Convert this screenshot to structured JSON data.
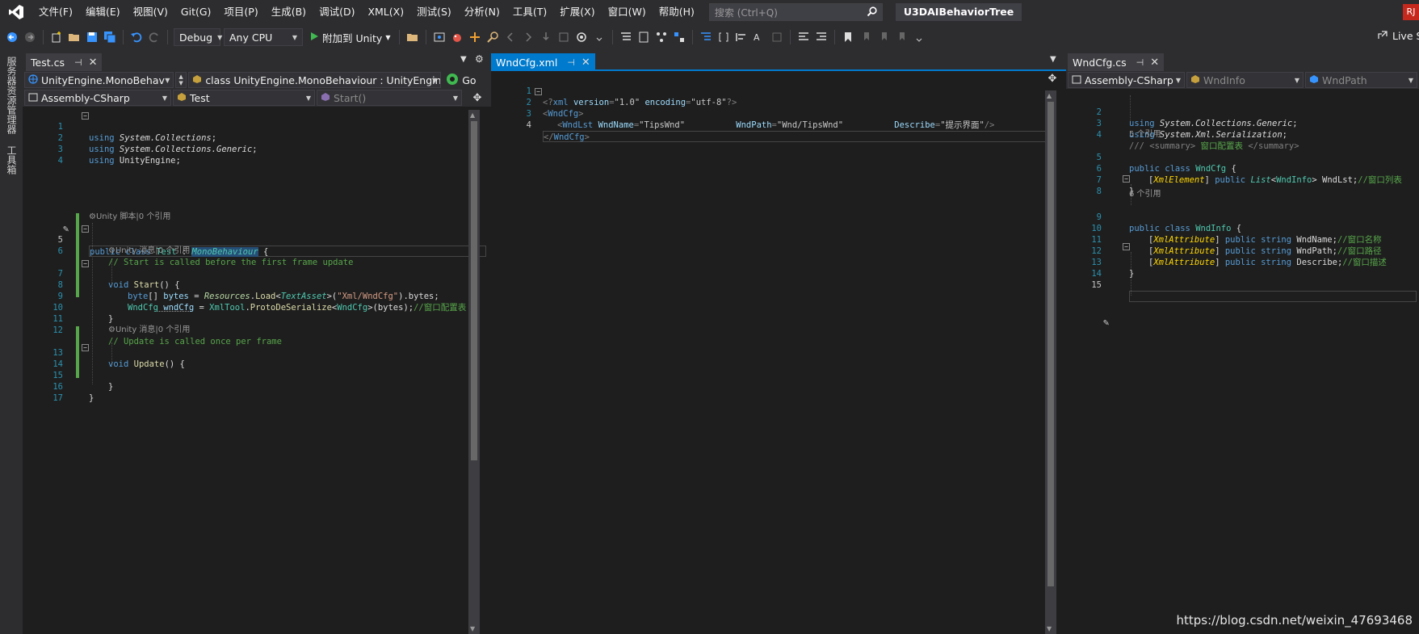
{
  "menubar": {
    "items": [
      "文件(F)",
      "编辑(E)",
      "视图(V)",
      "Git(G)",
      "项目(P)",
      "生成(B)",
      "调试(D)",
      "XML(X)",
      "测试(S)",
      "分析(N)",
      "工具(T)",
      "扩展(X)",
      "窗口(W)",
      "帮助(H)"
    ],
    "search_placeholder": "搜索 (Ctrl+Q)",
    "solution_name": "U3DAIBehaviorTree",
    "account_initials": "RJ"
  },
  "toolbar": {
    "config": "Debug",
    "platform": "Any CPU",
    "attach_label": "附加到 Unity",
    "live_share": "Live Share"
  },
  "side_tabs": [
    "服务器资源管理器",
    "工具箱"
  ],
  "left_panel": {
    "tab": "Test.cs",
    "nav1": "UnityEngine.MonoBehav",
    "nav2": "class UnityEngine.MonoBehaviour : UnityEngine.",
    "nav3": "Go",
    "nav4": "Assembly-CSharp",
    "nav5": "Test",
    "nav6": "Start()",
    "lens": {
      "l4": "Unity 脚本|0 个引用",
      "l6": "Unity 消息|0 个引用",
      "l12": "Unity 消息|0 个引用"
    },
    "line_numbers": [
      "1",
      "2",
      "3",
      "4",
      "5",
      "6",
      "7",
      "8",
      "9",
      "10",
      "11",
      "12",
      "13",
      "14",
      "15",
      "16",
      "17"
    ],
    "code": {
      "l1a": "using",
      "l1b": " System.Collections",
      "l1c": ";",
      "l2a": "using",
      "l2b": " System.Collections.Generic",
      "l2c": ";",
      "l3a": "using",
      "l3b": " UnityEngine",
      "l3c": ";",
      "l5a": "public",
      "l5b": " class ",
      "l5c": "Test",
      "l5d": " : ",
      "l5e": "MonoBehaviour",
      "l5f": " {",
      "l6": "// Start is called before the first frame update",
      "l7a": "void",
      "l7b": " Start",
      "l7c": "() {",
      "l8a": "byte",
      "l8b": "[] ",
      "l8c": "bytes",
      "l8d": " = ",
      "l8e": "Resources",
      "l8f": ".",
      "l8g": "Load",
      "l8h": "<",
      "l8i": "TextAsset",
      "l8j": ">(",
      "l8k": "\"Xml/WndCfg\"",
      "l8l": ").bytes;",
      "l9a": "WndCfg",
      "l9b": " wndCfg",
      "l9c": " = ",
      "l9d": "XmlTool",
      "l9e": ".",
      "l9f": "ProtoDeSerialize",
      "l9g": "<",
      "l9h": "WndCfg",
      "l9i": ">(bytes);",
      "l9j": "//窗口配置表",
      "l10": "}",
      "l12": "// Update is called once per frame",
      "l13a": "void",
      "l13b": " Update",
      "l13c": "() {",
      "l15": "}",
      "l16": "}"
    }
  },
  "mid_panel": {
    "tab": "WndCfg.xml",
    "line_numbers": [
      "1",
      "2",
      "3",
      "4"
    ],
    "code": {
      "l1a": "<?",
      "l1b": "xml",
      "l1c": " version",
      "l1d": "=",
      "l1e": "\"1.0\"",
      "l1f": " encoding",
      "l1g": "=",
      "l1h": "\"utf-8\"",
      "l1i": "?>",
      "l2a": "<",
      "l2b": "WndCfg",
      "l2c": ">",
      "l3a": "<",
      "l3b": "WndLst",
      "l3c": " WndName",
      "l3d": "=",
      "l3e": "\"TipsWnd\"",
      "l3f": "          WndPath",
      "l3g": "=",
      "l3h": "\"Wnd/TipsWnd\"",
      "l3i": "          Describe",
      "l3j": "=",
      "l3k": "\"提示界面\"",
      "l3l": "/>",
      "l4a": "</",
      "l4b": "WndCfg",
      "l4c": ">"
    }
  },
  "right_panel": {
    "tab": "WndCfg.cs",
    "nav1": "Assembly-CSharp",
    "nav2": "WndInfo",
    "nav3": "WndPath",
    "lens": {
      "l4": "5 个引用",
      "l8": "6 个引用"
    },
    "line_numbers": [
      "2",
      "3",
      "4",
      "5",
      "6",
      "7",
      "8",
      "9",
      "10",
      "11",
      "12",
      "13",
      "14",
      "15"
    ],
    "code": {
      "l2a": "using",
      "l2b": " System.Collections.Generic",
      "l2c": ";",
      "l3a": "using",
      "l3b": " System.Xml.Serialization",
      "l3c": ";",
      "l4a": "/// ",
      "l4b": "<summary>",
      "l4c": " 窗口配置表 ",
      "l4d": "</summary>",
      "l5a": "public",
      "l5b": " class ",
      "l5c": "WndCfg",
      "l5d": " {",
      "l6a": "[",
      "l6b": "XmlElement",
      "l6c": "] ",
      "l6d": "public",
      "l6e": " ",
      "l6f": "List",
      "l6g": "<",
      "l6h": "WndInfo",
      "l6i": "> WndLst;",
      "l6j": "//窗口列表",
      "l7": "}",
      "l9a": "public",
      "l9b": " class ",
      "l9c": "WndInfo",
      "l9d": " {",
      "l10a": "[",
      "l10b": "XmlAttribute",
      "l10c": "] ",
      "l10d": "public",
      "l10e": " ",
      "l10f": "string",
      "l10g": " WndName;",
      "l10h": "//窗口名称",
      "l11a": "[",
      "l11b": "XmlAttribute",
      "l11c": "] ",
      "l11d": "public",
      "l11e": " ",
      "l11f": "string",
      "l11g": " WndPath;",
      "l11h": "//窗口路径",
      "l12a": "[",
      "l12b": "XmlAttribute",
      "l12c": "] ",
      "l12d": "public",
      "l12e": " ",
      "l12f": "string",
      "l12g": " Describe;",
      "l12h": "//窗口描述",
      "l13": "}"
    }
  },
  "watermark": "https://blog.csdn.net/weixin_47693468"
}
